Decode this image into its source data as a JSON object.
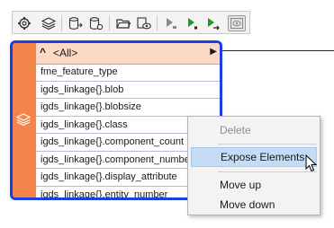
{
  "toolbar": {
    "buttons": [
      {
        "name": "settings-icon"
      },
      {
        "name": "layers-icon"
      },
      {
        "name": "database-export-icon"
      },
      {
        "name": "database-settings-icon"
      },
      {
        "name": "folder-open-icon"
      },
      {
        "name": "view-icon"
      },
      {
        "name": "run-to-here-icon"
      },
      {
        "name": "run-icon"
      },
      {
        "name": "run-step-icon"
      },
      {
        "name": "inspect-toggle-icon"
      }
    ]
  },
  "node": {
    "header_caret": "^",
    "header_label": "<All>",
    "header_arrow": "▶",
    "attributes": [
      "fme_feature_type",
      "igds_linkage{}.blob",
      "igds_linkage{}.blobsize",
      "igds_linkage{}.class",
      "igds_linkage{}.component_count",
      "igds_linkage{}.component_number",
      "igds_linkage{}.display_attribute",
      "igds_linkage{}.entity_number"
    ],
    "colors": {
      "border": "#1b3fe0",
      "side": "#f4844a",
      "header": "#fbd9c4"
    }
  },
  "context_menu": {
    "items": [
      {
        "label": "Delete",
        "enabled": false
      },
      {
        "label": "Expose Elements",
        "enabled": true,
        "highlighted": true
      },
      {
        "label": "Move up",
        "enabled": true
      },
      {
        "label": "Move down",
        "enabled": true
      }
    ]
  }
}
